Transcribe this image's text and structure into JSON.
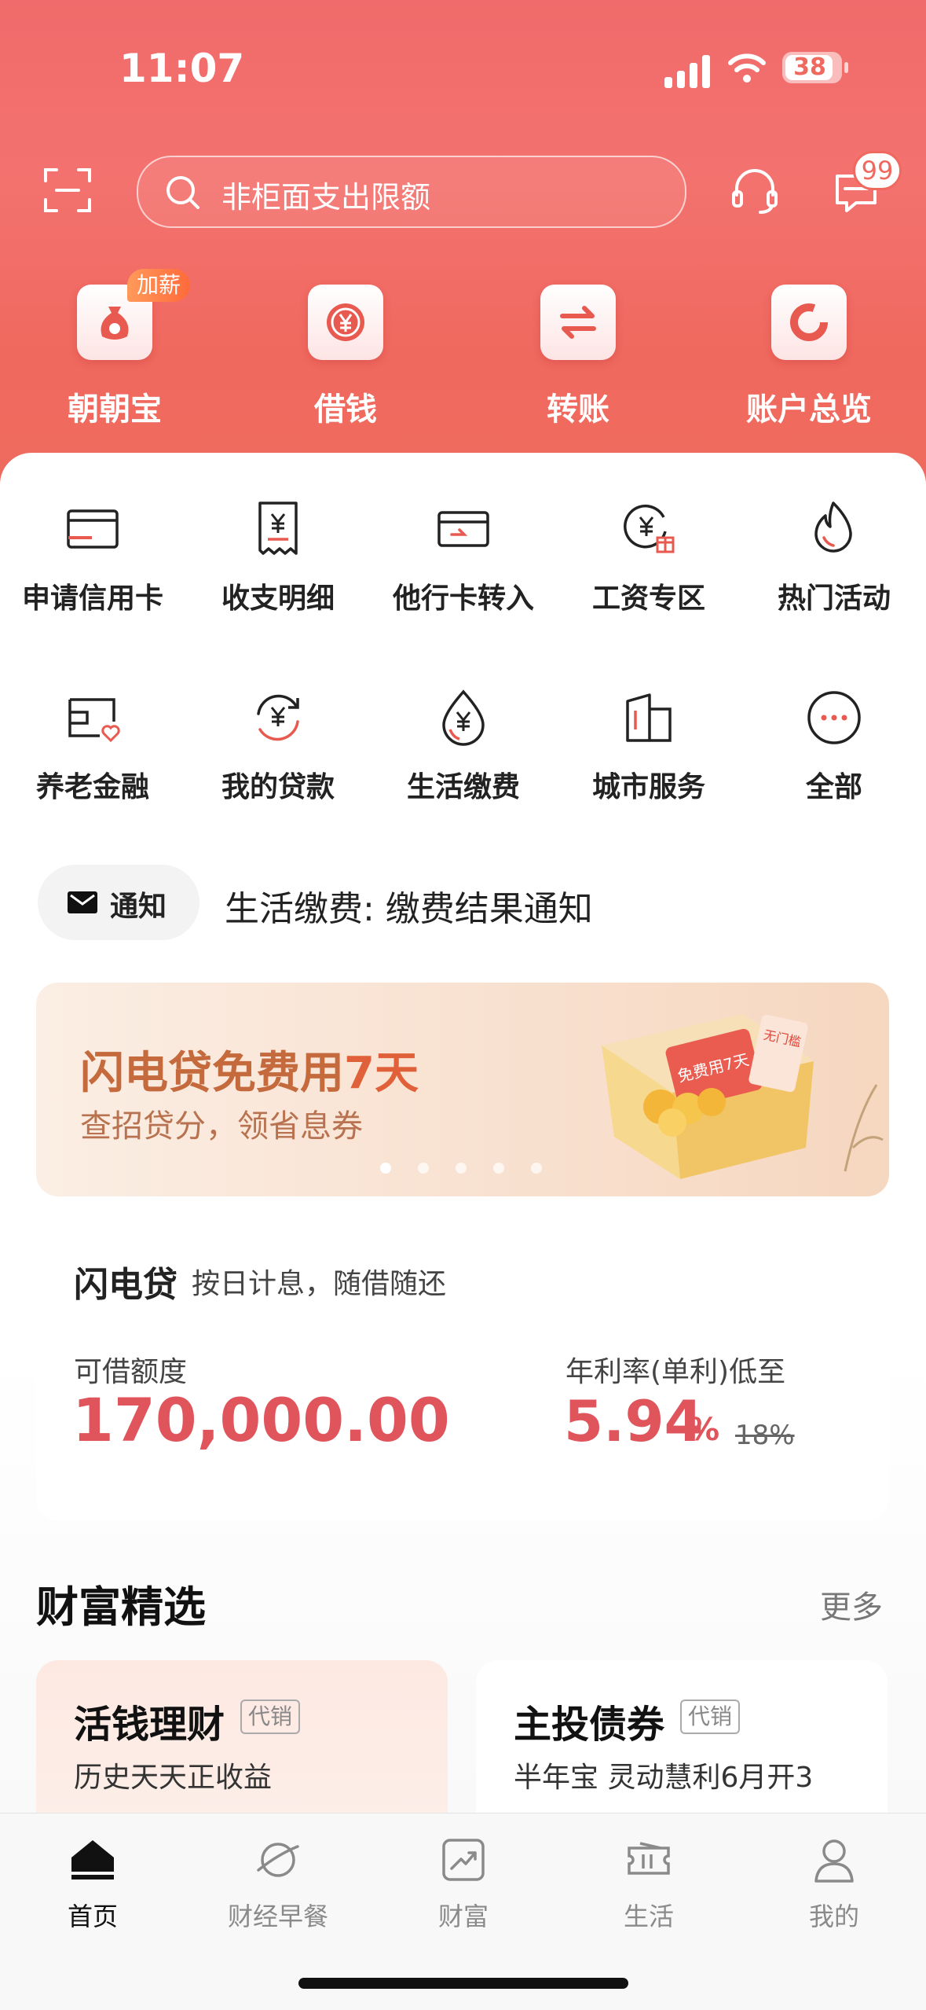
{
  "status_bar": {
    "time": "11:07",
    "battery": "38"
  },
  "header": {
    "search_placeholder": "非柜面支出限额",
    "message_badge": "99"
  },
  "top_features": [
    {
      "label": "朝朝宝",
      "tag": "加薪",
      "icon": "money-bag-icon"
    },
    {
      "label": "借钱",
      "icon": "yuan-coin-icon"
    },
    {
      "label": "转账",
      "icon": "transfer-arrows-icon"
    },
    {
      "label": "账户总览",
      "icon": "donut-chart-icon"
    }
  ],
  "grid_row1": [
    {
      "label": "申请信用卡",
      "icon": "credit-card-icon"
    },
    {
      "label": "收支明细",
      "icon": "receipt-yuan-icon"
    },
    {
      "label": "他行卡转入",
      "icon": "card-transfer-in-icon"
    },
    {
      "label": "工资专区",
      "icon": "salary-gift-icon"
    },
    {
      "label": "热门活动",
      "icon": "flame-icon"
    }
  ],
  "grid_row2": [
    {
      "label": "养老金融",
      "icon": "pension-card-icon"
    },
    {
      "label": "我的贷款",
      "icon": "loan-cycle-icon"
    },
    {
      "label": "生活缴费",
      "icon": "water-drop-yuan-icon"
    },
    {
      "label": "城市服务",
      "icon": "city-buildings-icon"
    },
    {
      "label": "全部",
      "icon": "more-dots-icon"
    }
  ],
  "notice": {
    "pill_label": "通知",
    "text": "生活缴费: 缴费结果通知"
  },
  "banner": {
    "title_prefix": "闪电贷免费用",
    "title_highlight": "7天",
    "subtitle": "查招贷分，领省息券",
    "art_ticket": "免费用7天",
    "art_tag": "无门槛",
    "page_count": 5,
    "active_page": 1
  },
  "loan": {
    "name": "闪电贷",
    "desc": "按日计息，随借随还",
    "amount_label": "可借额度",
    "amount": "170,000.00",
    "rate_label": "年利率(单利)低至",
    "rate": "5.94",
    "rate_unit": "%",
    "orig_rate": "18%"
  },
  "wealth": {
    "title": "财富精选",
    "more": "更多",
    "cards": [
      {
        "name": "活钱理财",
        "tag": "代销",
        "desc": "历史天天正收益"
      },
      {
        "name": "主投债券",
        "tag": "代销",
        "desc": "半年宝  灵动慧利6月开3"
      }
    ]
  },
  "tabbar": [
    {
      "label": "首页",
      "icon": "home-icon",
      "active": true
    },
    {
      "label": "财经早餐",
      "icon": "planet-icon"
    },
    {
      "label": "财富",
      "icon": "trend-chart-icon"
    },
    {
      "label": "生活",
      "icon": "ticket-icon"
    },
    {
      "label": "我的",
      "icon": "person-icon"
    }
  ],
  "colors": {
    "header": "#f0695f",
    "accent_red": "#e0545c",
    "banner_title": "#c56a3c"
  }
}
